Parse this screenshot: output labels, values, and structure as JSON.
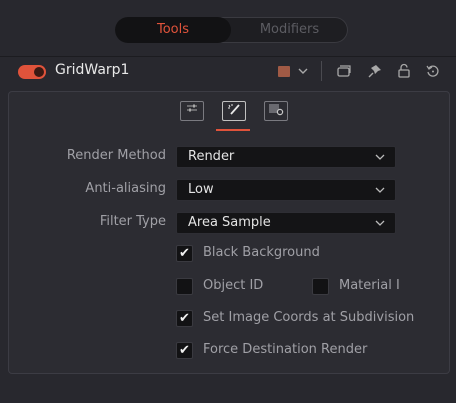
{
  "tabs": {
    "tools": "Tools",
    "modifiers": "Modifiers"
  },
  "node": {
    "title": "GridWarp1",
    "toggle_on": true,
    "color_swatch": "#a05a45"
  },
  "header_icons": [
    "color-swatch-icon",
    "chevron-down-icon",
    "versions-icon",
    "pin-icon",
    "lock-icon",
    "reset-icon"
  ],
  "subtabs": [
    "controls-icon",
    "settings-wand-icon",
    "render-settings-icon"
  ],
  "settings": {
    "render_method": {
      "label": "Render Method",
      "value": "Render"
    },
    "anti_aliasing": {
      "label": "Anti-aliasing",
      "value": "Low"
    },
    "filter_type": {
      "label": "Filter Type",
      "value": "Area Sample"
    }
  },
  "checkboxes": {
    "black_background": {
      "label": "Black Background",
      "checked": true
    },
    "object_id": {
      "label": "Object ID",
      "checked": false
    },
    "material_id": {
      "label": "Material I",
      "checked": false
    },
    "set_image_coords": {
      "label": "Set Image Coords at Subdivision",
      "checked": true
    },
    "force_destination": {
      "label": "Force Destination Render",
      "checked": true
    }
  },
  "colors": {
    "accent": "#e0533b",
    "background": "#28282e",
    "field": "#141416"
  }
}
